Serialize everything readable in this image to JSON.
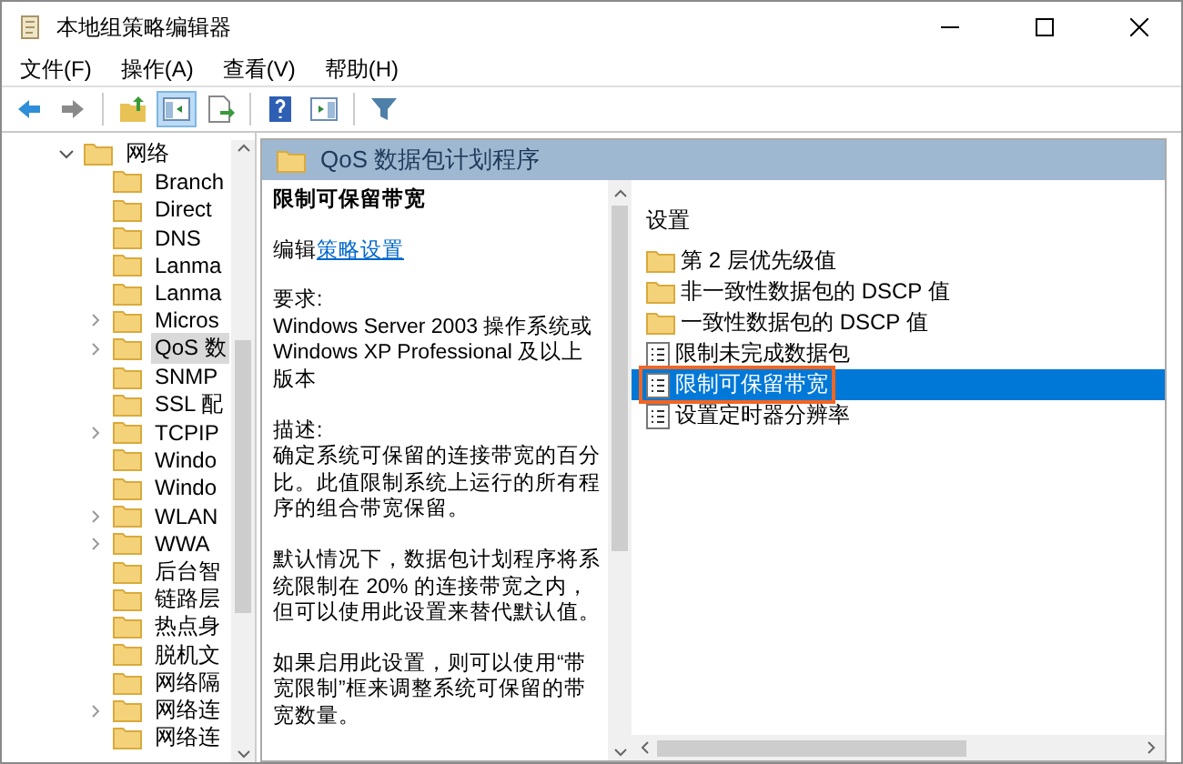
{
  "window": {
    "title": "本地组策略编辑器"
  },
  "menu": [
    "文件(F)",
    "操作(A)",
    "查看(V)",
    "帮助(H)"
  ],
  "toolbar": [
    {
      "kind": "back",
      "selected": false
    },
    {
      "kind": "forward",
      "selected": false
    },
    {
      "kind": "up",
      "selected": false
    },
    {
      "kind": "tree",
      "selected": true
    },
    {
      "kind": "export",
      "selected": false
    },
    {
      "kind": "help",
      "selected": false
    },
    {
      "kind": "pane",
      "selected": false
    },
    {
      "kind": "filter",
      "selected": false
    }
  ],
  "tree": {
    "label": "网络",
    "expanded": true,
    "selected": false,
    "children": [
      {
        "label": "Branch",
        "expandable": false,
        "selected": false
      },
      {
        "label": "Direct",
        "expandable": false,
        "selected": false
      },
      {
        "label": "DNS",
        "expandable": false,
        "selected": false
      },
      {
        "label": "Lanma",
        "expandable": false,
        "selected": false
      },
      {
        "label": "Lanma",
        "expandable": false,
        "selected": false
      },
      {
        "label": "Micros",
        "expandable": true,
        "selected": false
      },
      {
        "label": "QoS 数",
        "expandable": true,
        "selected": true
      },
      {
        "label": "SNMP",
        "expandable": false,
        "selected": false
      },
      {
        "label": "SSL 配",
        "expandable": false,
        "selected": false
      },
      {
        "label": "TCPIP",
        "expandable": true,
        "selected": false
      },
      {
        "label": "Windo",
        "expandable": false,
        "selected": false
      },
      {
        "label": "Windo",
        "expandable": false,
        "selected": false
      },
      {
        "label": "WLAN",
        "expandable": true,
        "selected": false
      },
      {
        "label": "WWA",
        "expandable": true,
        "selected": false
      },
      {
        "label": "后台智",
        "expandable": false,
        "selected": false
      },
      {
        "label": "链路层",
        "expandable": false,
        "selected": false
      },
      {
        "label": "热点身",
        "expandable": false,
        "selected": false
      },
      {
        "label": "脱机文",
        "expandable": false,
        "selected": false
      },
      {
        "label": "网络隔",
        "expandable": false,
        "selected": false
      },
      {
        "label": "网络连",
        "expandable": true,
        "selected": false
      },
      {
        "label": "网络连",
        "expandable": false,
        "selected": false
      }
    ]
  },
  "header": {
    "title": "QoS 数据包计划程序"
  },
  "description": {
    "title": "限制可保留带宽",
    "edit_prefix": "编辑",
    "edit_link": "策略设置",
    "paragraphs": [
      "要求:\nWindows Server 2003 操作系统或 Windows XP Professional 及以上版本",
      "描述:\n确定系统可保留的连接带宽的百分比。此值限制系统上运行的所有程序的组合带宽保留。",
      "默认情况下，数据包计划程序将系统限制在 20% 的连接带宽之内，但可以使用此设置来替代默认值。",
      "如果启用此设置，则可以使用“带宽限制”框来调整系统可保留的带宽数量。"
    ]
  },
  "settings": {
    "column": "设置",
    "items": [
      {
        "label": "第 2 层优先级值",
        "kind": "folder",
        "selected": false,
        "highlighted": false
      },
      {
        "label": "非一致性数据包的 DSCP 值",
        "kind": "folder",
        "selected": false,
        "highlighted": false
      },
      {
        "label": "一致性数据包的 DSCP 值",
        "kind": "folder",
        "selected": false,
        "highlighted": false
      },
      {
        "label": "限制未完成数据包",
        "kind": "policy",
        "selected": false,
        "highlighted": false
      },
      {
        "label": "限制可保留带宽",
        "kind": "policy",
        "selected": true,
        "highlighted": true
      },
      {
        "label": "设置定时器分辨率",
        "kind": "policy",
        "selected": false,
        "highlighted": false
      }
    ]
  }
}
